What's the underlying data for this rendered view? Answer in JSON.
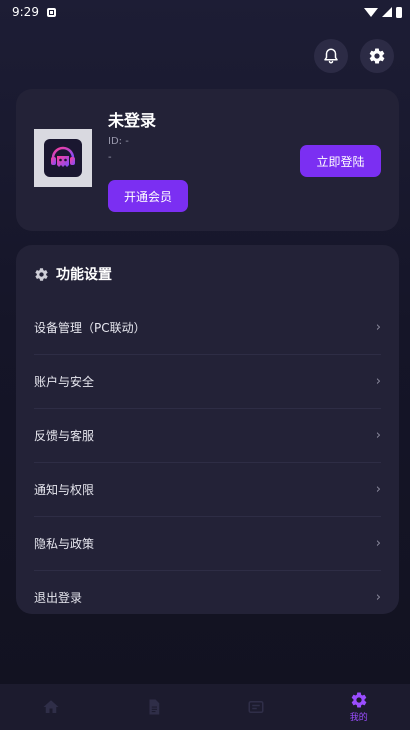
{
  "status_bar": {
    "time": "9:29"
  },
  "profile": {
    "name": "未登录",
    "id_line": "ID: -",
    "sub_line": "-",
    "vip_button": "开通会员",
    "login_button": "立即登陆"
  },
  "settings": {
    "title": "功能设置",
    "items": [
      {
        "label": "设备管理（PC联动）",
        "chevron": "›"
      },
      {
        "label": "账户与安全",
        "chevron": "›"
      },
      {
        "label": "反馈与客服",
        "chevron": "›"
      },
      {
        "label": "通知与权限",
        "chevron": "›"
      },
      {
        "label": "隐私与政策",
        "chevron": "›"
      },
      {
        "label": "退出登录",
        "chevron": "›"
      }
    ]
  },
  "bottom_nav": {
    "items": [
      {
        "icon": "home-icon",
        "label": ""
      },
      {
        "icon": "document-icon",
        "label": ""
      },
      {
        "icon": "message-icon",
        "label": ""
      },
      {
        "icon": "gear-icon",
        "label": "我的"
      }
    ]
  },
  "colors": {
    "accent": "#7b2ff2",
    "card": "#232237",
    "background": "#151528",
    "nav_active": "#9a4dff",
    "nav_inactive": "#2a2940"
  }
}
